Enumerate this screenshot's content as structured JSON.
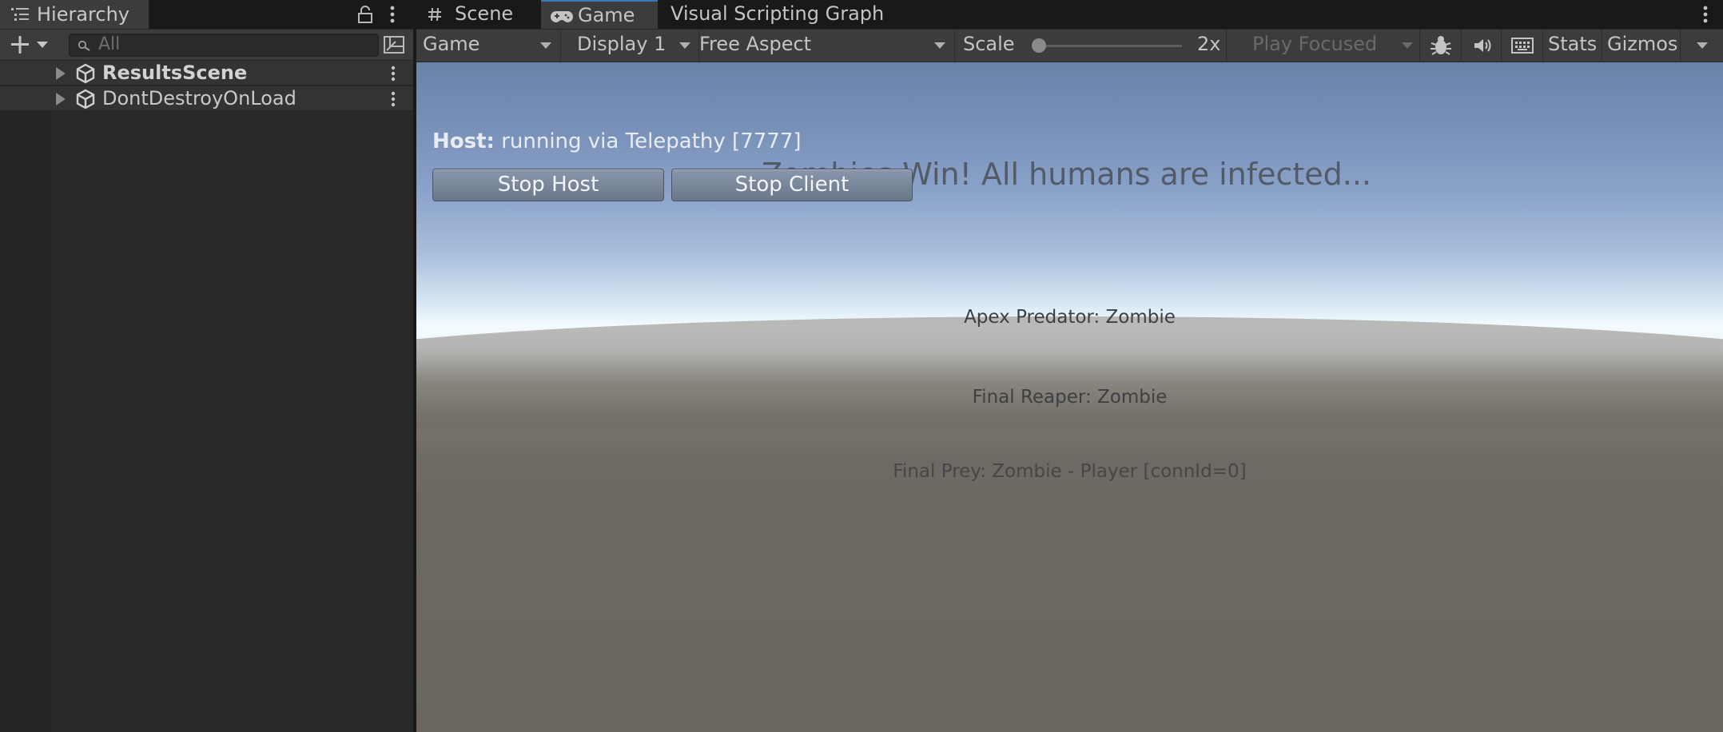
{
  "hierarchy": {
    "tab_label": "Hierarchy",
    "search_placeholder": "All",
    "items": [
      {
        "label": "ResultsScene",
        "bold": true
      },
      {
        "label": "DontDestroyOnLoad",
        "bold": false
      }
    ]
  },
  "editor_tabs": [
    {
      "label": "Scene",
      "icon": "grid-icon"
    },
    {
      "label": "Game",
      "icon": "gamepad-icon",
      "active": true
    },
    {
      "label": "Visual Scripting Graph"
    }
  ],
  "game_toolbar": {
    "view_dropdown": "Game",
    "display_dropdown": "Display 1",
    "aspect_dropdown": "Free Aspect",
    "scale_label": "Scale",
    "scale_value": "2x",
    "scale_level": 0.0,
    "play_mode_dropdown": "Play Focused",
    "stats_label": "Stats",
    "gizmos_label": "Gizmos",
    "icons": [
      "bug-icon",
      "audio-mute-icon",
      "keyboard-icon"
    ]
  },
  "game_view": {
    "host_prefix": "Host:",
    "host_status": " running via Telepathy [7777]",
    "stop_host_label": "Stop Host",
    "stop_client_label": "Stop Client",
    "win_message": "Zombies Win! All humans are infected...",
    "apex_predator": "Apex Predator: Zombie",
    "final_reaper": "Final Reaper: Zombie",
    "final_prey": "Final Prey: Zombie - Player [connId=0]"
  },
  "colors": {
    "editor_bg": "#282828",
    "toolbar_bg": "#3c3c3c",
    "active_tab_accent": "#3a79bb",
    "sky_top": "#6b83a9",
    "horizon": "#f3fbff",
    "ground": "#6a655f"
  }
}
